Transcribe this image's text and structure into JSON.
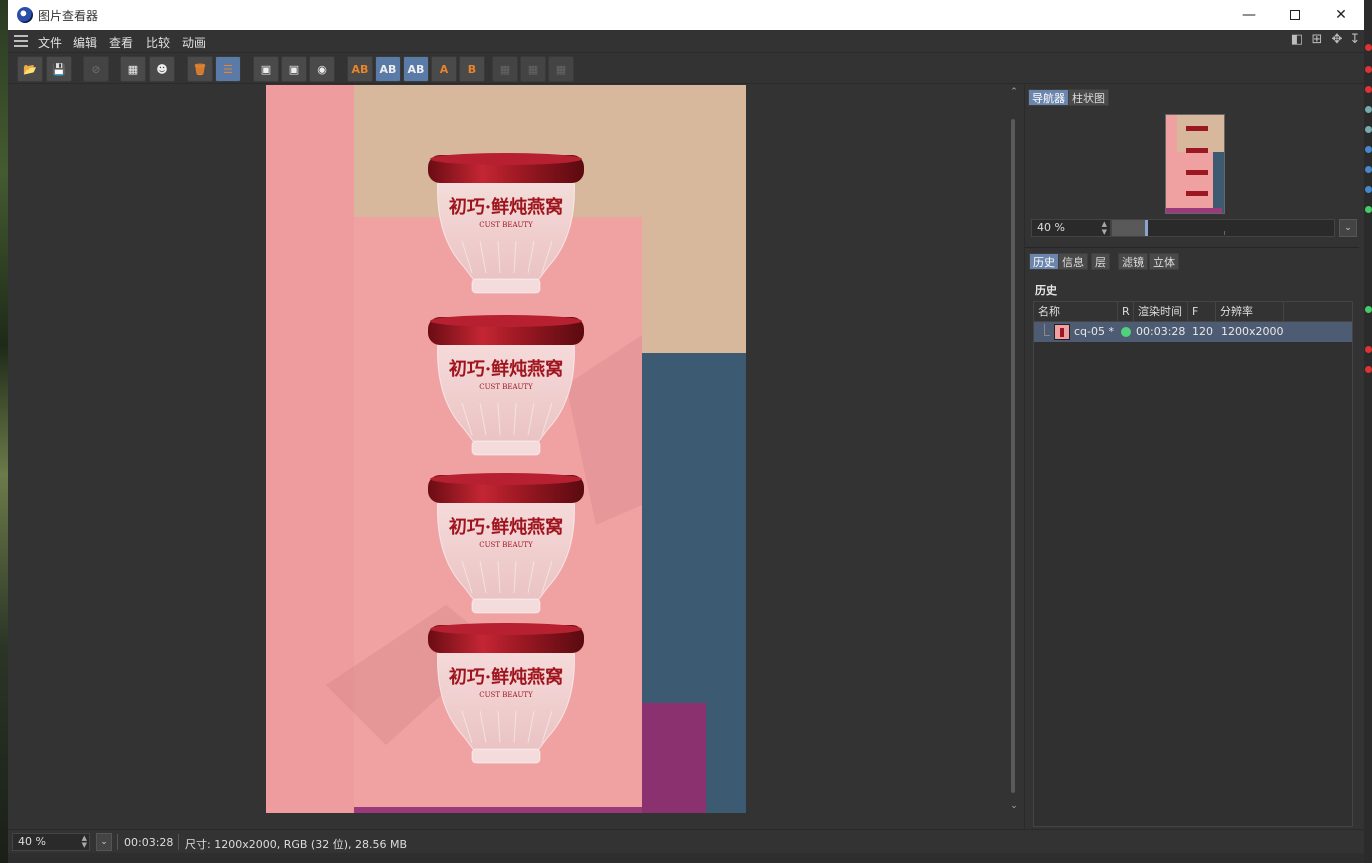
{
  "window": {
    "title": "图片查看器"
  },
  "menu": {
    "items": [
      "文件",
      "编辑",
      "查看",
      "比较",
      "动画"
    ]
  },
  "navigator": {
    "tabs": [
      {
        "label": "导航器",
        "active": true
      },
      {
        "label": "柱状图",
        "active": false
      }
    ],
    "zoom": "40 %",
    "zoom_fraction": 0.15
  },
  "info_panel": {
    "tabs": [
      {
        "label": "历史",
        "active": true
      },
      {
        "label": "信息",
        "active": false
      },
      {
        "label": "层",
        "active": false
      },
      {
        "label": "滤镜",
        "active": false
      },
      {
        "label": "立体",
        "active": false
      }
    ],
    "section_title": "历史",
    "columns": [
      "名称",
      "R",
      "渲染时间",
      "F",
      "分辨率"
    ],
    "rows": [
      {
        "name": "cq-05 *",
        "status_color": "#4fd37a",
        "render_time": "00:03:28",
        "frame": "120",
        "resolution": "1200x2000"
      }
    ]
  },
  "image": {
    "product_text": "初巧·鲜炖燕窝",
    "product_subtext": "CUST BEAUTY",
    "lid_color": "#9b1822",
    "background_colors": {
      "pink": "#f0a3a3",
      "beige": "#d6b69b",
      "blue": "#3b5a73",
      "purple": "#9a3a7a"
    }
  },
  "status": {
    "zoom": "40 %",
    "time": "00:03:28",
    "info": "尺寸: 1200x2000, RGB (32 位), 28.56 MB"
  }
}
